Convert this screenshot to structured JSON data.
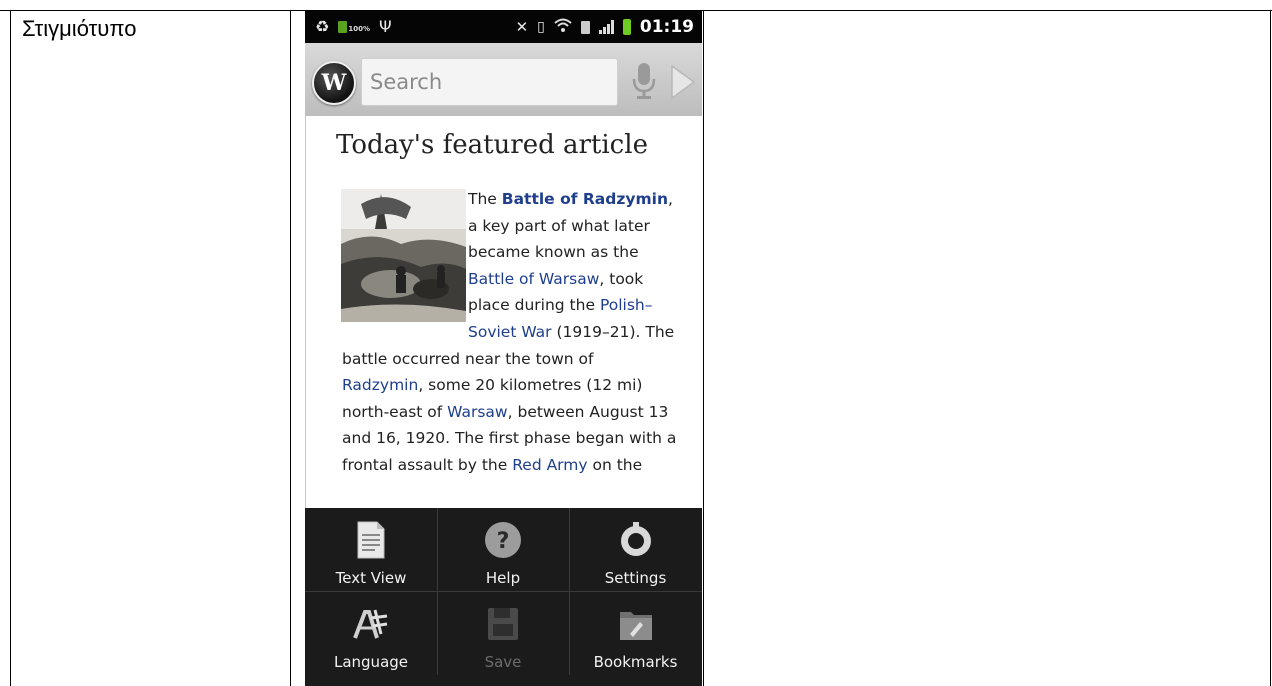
{
  "table": {
    "label": "Στιγμιότυπο"
  },
  "status_bar": {
    "icons": [
      "recycle-icon",
      "battery-icon",
      "usb-icon",
      "mute-icon",
      "vibrate-icon",
      "wifi-icon",
      "sim-icon",
      "signal-icon",
      "battery-icon"
    ],
    "battery_label": "100%",
    "time": "01:19"
  },
  "search": {
    "placeholder": "Search",
    "logo_letter": "W"
  },
  "article": {
    "heading": "Today's featured article",
    "segments": {
      "s1": "The ",
      "l1": "Battle of Radzymin",
      "s2": ", a key part of what later became known as the ",
      "l2": "Battle of Warsaw",
      "s3": ", took place during the ",
      "l3": "Polish–Soviet War",
      "s4": " (1919–21). The battle occurred near the town of ",
      "l4": "Radzymin",
      "s5": ", some 20 kilometres (12 mi) north-east of ",
      "l5": "Warsaw",
      "s6": ", between August 13 and 16, 1920. The first phase began with a frontal assault by the ",
      "l6": "Red Army",
      "s7": " on the"
    }
  },
  "menu": {
    "items": [
      {
        "label": "Text View",
        "icon": "document-icon",
        "enabled": true
      },
      {
        "label": "Help",
        "icon": "help-icon",
        "enabled": true
      },
      {
        "label": "Settings",
        "icon": "settings-icon",
        "enabled": true
      },
      {
        "label": "Language",
        "icon": "language-icon",
        "enabled": true
      },
      {
        "label": "Save",
        "icon": "save-icon",
        "enabled": false
      },
      {
        "label": "Bookmarks",
        "icon": "bookmarks-icon",
        "enabled": true
      }
    ]
  },
  "colors": {
    "link": "#1f3f8c",
    "menu_bg": "#1b1b1b",
    "battery": "#6ecb24"
  }
}
